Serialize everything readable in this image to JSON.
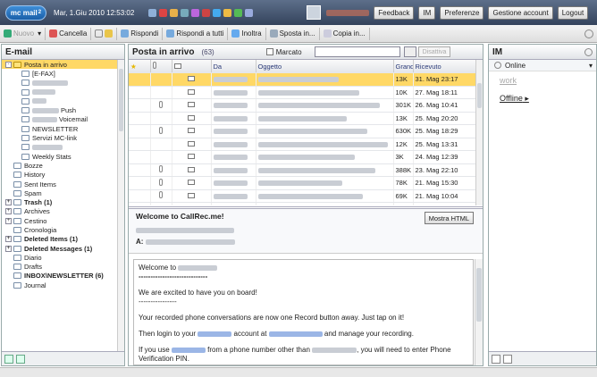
{
  "app": {
    "logo": "mc mail",
    "logo_sup": "2",
    "date": "Mar, 1.Giu 2010 12:53:02"
  },
  "topbar": {
    "buttons": [
      "Feedback",
      "IM",
      "Preferenze",
      "Gestione account",
      "Logout"
    ]
  },
  "toolbar": {
    "items": [
      "Nuovo",
      "Cancella",
      "Rispondi",
      "Rispondi a tutti",
      "Inoltra",
      "Sposta in...",
      "Copia in..."
    ]
  },
  "left": {
    "title": "E-mail",
    "folders": [
      {
        "label": "Posta in arrivo",
        "selected": true,
        "expander": "-"
      },
      {
        "label": "[E-FAX]",
        "indent": 1
      },
      {
        "label": "",
        "indent": 1,
        "blur": 40
      },
      {
        "label": "",
        "indent": 1,
        "blur": 26
      },
      {
        "label": "",
        "indent": 1,
        "blur": 16
      },
      {
        "label": "Push",
        "indent": 1,
        "blur": 30
      },
      {
        "label": "Voicemail",
        "indent": 1,
        "blur": 28
      },
      {
        "label": "NEWSLETTER",
        "indent": 1
      },
      {
        "label": "Servizi MC-link",
        "indent": 1
      },
      {
        "label": "",
        "indent": 1,
        "blur": 34
      },
      {
        "label": "Weekly Stats",
        "indent": 1
      },
      {
        "label": "Bozze"
      },
      {
        "label": "History"
      },
      {
        "label": "Sent Items"
      },
      {
        "label": "Spam"
      },
      {
        "label": "Trash (1)",
        "bold": true,
        "expander": "+"
      },
      {
        "label": "Archives",
        "expander": "+"
      },
      {
        "label": "Cestino",
        "expander": "+"
      },
      {
        "label": "Cronologia"
      },
      {
        "label": "Deleted Items (1)",
        "bold": true,
        "expander": "+"
      },
      {
        "label": "Deleted Messages (1)",
        "bold": true,
        "expander": "+"
      },
      {
        "label": "Diario"
      },
      {
        "label": "Drafts"
      },
      {
        "label": "INBOX\\NEWSLETTER (6)",
        "bold": true
      },
      {
        "label": "Journal"
      }
    ]
  },
  "center": {
    "title": "Posta in arrivo",
    "count": "(63)",
    "marcato": "Marcato",
    "disattiva": "Disattiva",
    "columns": [
      "Da",
      "Oggetto",
      "Grand",
      "Ricevuto"
    ],
    "rows": [
      {
        "clip": false,
        "size": "13K",
        "date": "31. Mag 23:17",
        "sel": true
      },
      {
        "clip": false,
        "size": "10K",
        "date": "27. Mag 18:11"
      },
      {
        "clip": true,
        "size": "301K",
        "date": "26. Mag 10:41"
      },
      {
        "clip": false,
        "size": "13K",
        "date": "25. Mag 20:20"
      },
      {
        "clip": true,
        "size": "630K",
        "date": "25. Mag 18:29"
      },
      {
        "clip": false,
        "size": "12K",
        "date": "25. Mag 13:31"
      },
      {
        "clip": false,
        "size": "3K",
        "date": "24. Mag 12:39"
      },
      {
        "clip": true,
        "size": "388K",
        "date": "23. Mag 22:10"
      },
      {
        "clip": true,
        "size": "78K",
        "date": "21. Mag 15:30"
      },
      {
        "clip": true,
        "size": "69K",
        "date": "21. Mag 10:04"
      },
      {
        "clip": false,
        "size": "3K",
        "date": "20. Mag 21:46"
      }
    ],
    "preview": {
      "subject": "Welcome to CallRec.me!",
      "from_label": "",
      "to_label": "A:",
      "mostra": "Mostra HTML",
      "body": {
        "greeting": "Welcome to",
        "rule": "-----------------------------",
        "p1": "We are excited to have you on board!",
        "rule2": "----------------",
        "p2": "Your recorded phone conversations are now one Record button away. Just tap on it!",
        "p3a": "Then login to your",
        "p3b": "account at",
        "p3c": "and manage your recording.",
        "p4a": "If you use",
        "p4b": "from a phone number other than",
        "p4c": ", you will need to enter Phone Verification PIN."
      }
    }
  },
  "right": {
    "title": "IM",
    "status": "Online",
    "work": "work",
    "offline": "Offline"
  }
}
